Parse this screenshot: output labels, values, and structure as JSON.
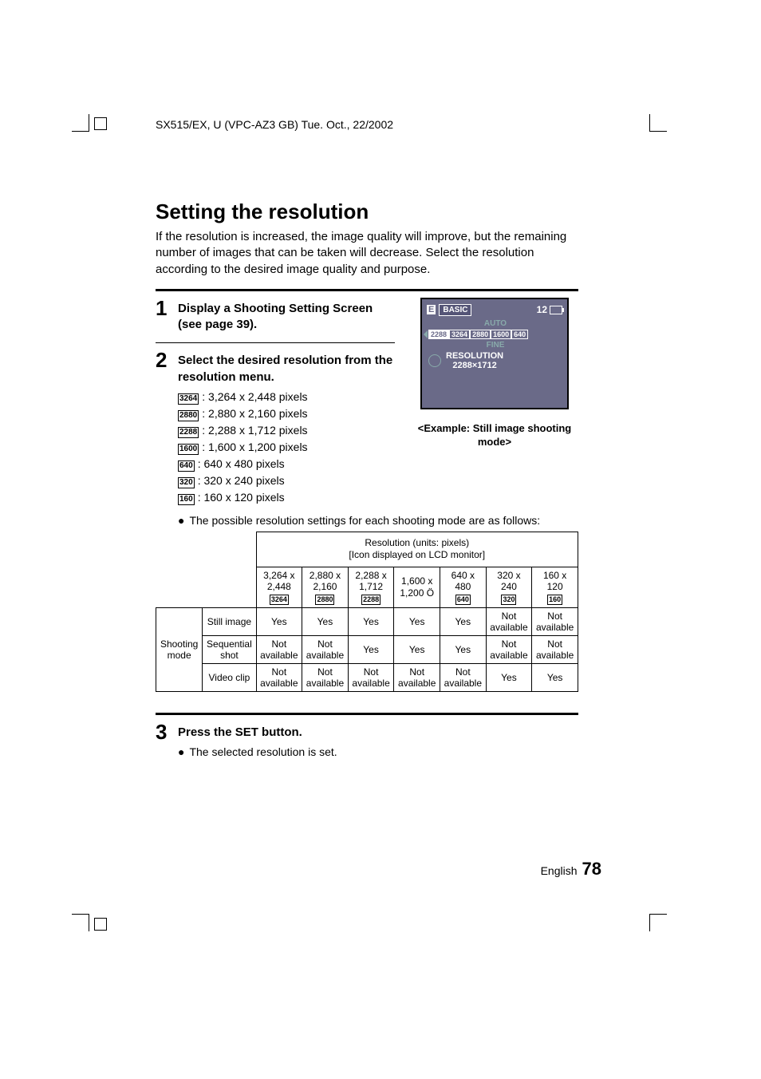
{
  "header": "SX515/EX, U (VPC-AZ3 GB)    Tue. Oct., 22/2002",
  "title": "Setting the resolution",
  "intro": "If the resolution is increased, the image quality will improve, but the remaining number of images that can be taken will decrease. Select the resolution according to the desired image quality and purpose.",
  "steps": {
    "s1": {
      "num": "1",
      "title": "Display a Shooting Setting Screen (see page 39)."
    },
    "s2": {
      "num": "2",
      "title": "Select the desired resolution from the resolution menu.",
      "items": [
        {
          "icon": "3264",
          "text": ":  3,264 x 2,448 pixels"
        },
        {
          "icon": "2880",
          "text": ":  2,880 x 2,160 pixels"
        },
        {
          "icon": "2288",
          "text": ":  2,288 x 1,712 pixels"
        },
        {
          "icon": "1600",
          "text": ":  1,600 x 1,200 pixels"
        },
        {
          "icon": "640",
          "text": ":  640 x 480 pixels"
        },
        {
          "icon": "320",
          "text": ":  320 x 240 pixels"
        },
        {
          "icon": "160",
          "text": ":  160 x 120 pixels"
        }
      ],
      "note": "The possible resolution settings for each shooting mode are as follows:"
    },
    "s3": {
      "num": "3",
      "title": "Press the SET button.",
      "note": "The selected resolution is set."
    }
  },
  "lcd": {
    "tag_e": "E",
    "basic": "BASIC",
    "count": "12",
    "auto": "AUTO",
    "options": [
      "2288",
      "3264",
      "2880",
      "1600",
      "640"
    ],
    "fine": "FINE",
    "line1": "RESOLUTION",
    "line2": "2288×1712",
    "caption": "<Example: Still image shooting mode>"
  },
  "table": {
    "head": "Resolution (units: pixels)\n[Icon displayed on LCD monitor]",
    "cols": [
      {
        "l1": "3,264 x",
        "l2": "2,448",
        "icon": "3264"
      },
      {
        "l1": "2,880 x",
        "l2": "2,160",
        "icon": "2880"
      },
      {
        "l1": "2,288 x",
        "l2": "1,712",
        "icon": "2288"
      },
      {
        "l1": "1,600 x",
        "l2": "1,200 Ö",
        "icon": ""
      },
      {
        "l1": "640 x",
        "l2": "480",
        "icon": "640"
      },
      {
        "l1": "320 x",
        "l2": "240",
        "icon": "320"
      },
      {
        "l1": "160 x",
        "l2": "120",
        "icon": "160"
      }
    ],
    "group": "Shooting mode",
    "rows": [
      {
        "label": "Still image",
        "cells": [
          "Yes",
          "Yes",
          "Yes",
          "Yes",
          "Yes",
          "Not available",
          "Not available"
        ]
      },
      {
        "label": "Sequential shot",
        "cells": [
          "Not available",
          "Not available",
          "Yes",
          "Yes",
          "Yes",
          "Not available",
          "Not available"
        ]
      },
      {
        "label": "Video clip",
        "cells": [
          "Not available",
          "Not available",
          "Not available",
          "Not available",
          "Not available",
          "Yes",
          "Yes"
        ]
      }
    ]
  },
  "footer": {
    "lang": "English",
    "page": "78"
  }
}
